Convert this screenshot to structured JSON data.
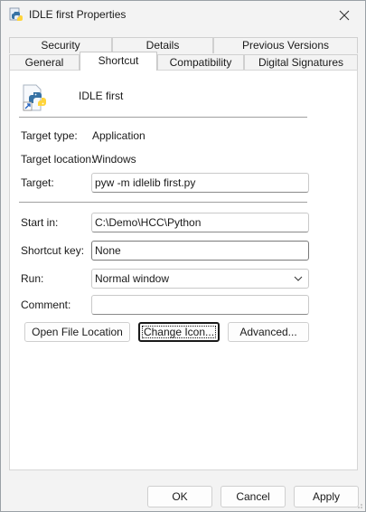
{
  "window": {
    "title": "IDLE first Properties",
    "close_icon": "close-icon"
  },
  "tabs_row1": [
    {
      "label": "Security"
    },
    {
      "label": "Details"
    },
    {
      "label": "Previous Versions"
    }
  ],
  "tabs_row2": [
    {
      "label": "General"
    },
    {
      "label": "Shortcut",
      "active": true
    },
    {
      "label": "Compatibility"
    },
    {
      "label": "Digital Signatures"
    }
  ],
  "shortcut": {
    "name": "IDLE first",
    "target_type_label": "Target type:",
    "target_type_value": "Application",
    "target_location_label": "Target location:",
    "target_location_value": "Windows",
    "target_label": "Target:",
    "target_value": "pyw -m idlelib first.py",
    "start_in_label": "Start in:",
    "start_in_value": "C:\\Demo\\HCC\\Python",
    "shortcut_key_label": "Shortcut key:",
    "shortcut_key_value": "None",
    "run_label": "Run:",
    "run_value": "Normal window",
    "comment_label": "Comment:",
    "comment_value": "",
    "open_file_location_label": "Open File Location",
    "change_icon_label": "Change Icon...",
    "advanced_label": "Advanced..."
  },
  "footer": {
    "ok_label": "OK",
    "cancel_label": "Cancel",
    "apply_label": "Apply"
  },
  "colors": {
    "panel_bg": "#ffffff",
    "dialog_bg": "#f3f3f3",
    "python_blue": "#3772a4",
    "python_yellow": "#ffd43b"
  }
}
